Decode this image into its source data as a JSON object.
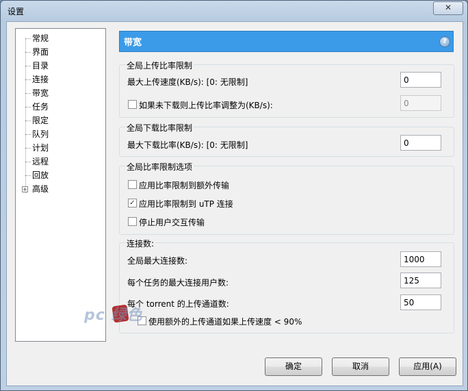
{
  "window": {
    "title": "设置",
    "close_glyph": "✕"
  },
  "tree": {
    "items": [
      "常规",
      "界面",
      "目录",
      "连接",
      "带宽",
      "任务",
      "限定",
      "队列",
      "计划",
      "远程",
      "回放",
      "高级"
    ],
    "expander_glyph": "+"
  },
  "header": {
    "title": "带宽",
    "help_glyph": "?"
  },
  "upload_group": {
    "legend": "全局上传比率限制",
    "max_upload_label": "最大上传速度(KB/s): [0: 无限制]",
    "max_upload_value": "0",
    "auto_label": "如果未下载则上传比率调整为(KB/s):",
    "auto_checked": false,
    "auto_value": "0"
  },
  "download_group": {
    "legend": "全局下载比率限制",
    "max_download_label": "最大下载比率(KB/s): [0: 无限制]",
    "max_download_value": "0"
  },
  "options_group": {
    "legend": "全局比率限制选项",
    "overhead_label": "应用比率限制到额外传输",
    "overhead_checked": false,
    "utp_label": "应用比率限制到 uTP 连接",
    "utp_checked": true,
    "lan_label": "停止用户交互传输",
    "lan_checked": false
  },
  "connections_group": {
    "legend": "连接数:",
    "global_max_label": "全局最大连接数:",
    "global_max_value": "1000",
    "per_task_label": "每个任务的最大连接用户数:",
    "per_task_value": "125",
    "upload_slots_label": "每个 torrent 的上传通道数:",
    "upload_slots_value": "50",
    "extra_slots_label": "使用额外的上传通道如果上传速度 < 90%",
    "extra_slots_checked": false
  },
  "buttons": {
    "ok": "确定",
    "cancel": "取消",
    "apply": "应用(A)"
  },
  "watermark": {
    "text": "pc 绿色"
  },
  "colors": {
    "header_bg": "#3b9be8",
    "window_frame": "#b7cbe0"
  }
}
